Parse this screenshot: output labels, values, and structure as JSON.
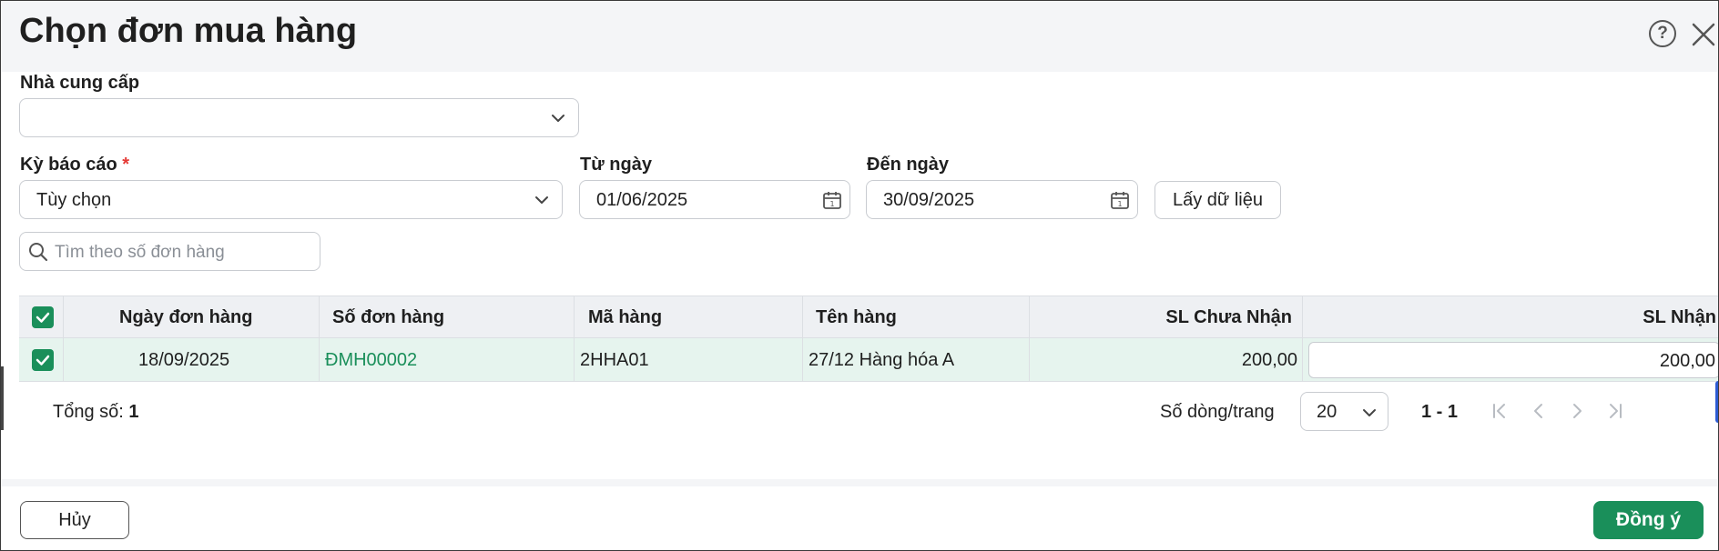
{
  "dialog": {
    "title": "Chọn đơn mua hàng",
    "help_icon": "question-circle-icon",
    "close_icon": "close-icon"
  },
  "filters": {
    "supplier_label": "Nhà cung cấp",
    "supplier_value": "",
    "period_label": "Kỳ báo cáo",
    "required_mark": "*",
    "period_value": "Tùy chọn",
    "from_label": "Từ ngày",
    "from_value": "01/06/2025",
    "to_label": "Đến ngày",
    "to_value": "30/09/2025",
    "get_data_label": "Lấy dữ liệu"
  },
  "search": {
    "placeholder": "Tìm theo số đơn hàng"
  },
  "table": {
    "columns": [
      "Ngày đơn hàng",
      "Số đơn hàng",
      "Mã hàng",
      "Tên hàng",
      "SL Chưa Nhận",
      "SL Nhận"
    ],
    "rows": [
      {
        "checked": true,
        "order_date": "18/09/2025",
        "order_no": "ĐMH00002",
        "item_code": "2HHA01",
        "item_name": "27/12 Hàng hóa A",
        "qty_pending": "200,00",
        "qty_received": "200,00"
      }
    ]
  },
  "pagination": {
    "total_label": "Tổng số:",
    "total_value": "1",
    "rows_per_page_label": "Số dòng/trang",
    "rows_per_page_value": "20",
    "range": "1 - 1"
  },
  "footer": {
    "cancel_label": "Hủy",
    "ok_label": "Đồng ý"
  },
  "colors": {
    "accent": "#1a8f5a",
    "selected_row": "#e6f4ee",
    "header_bg": "#f4f5f7",
    "required": "#e53935"
  }
}
